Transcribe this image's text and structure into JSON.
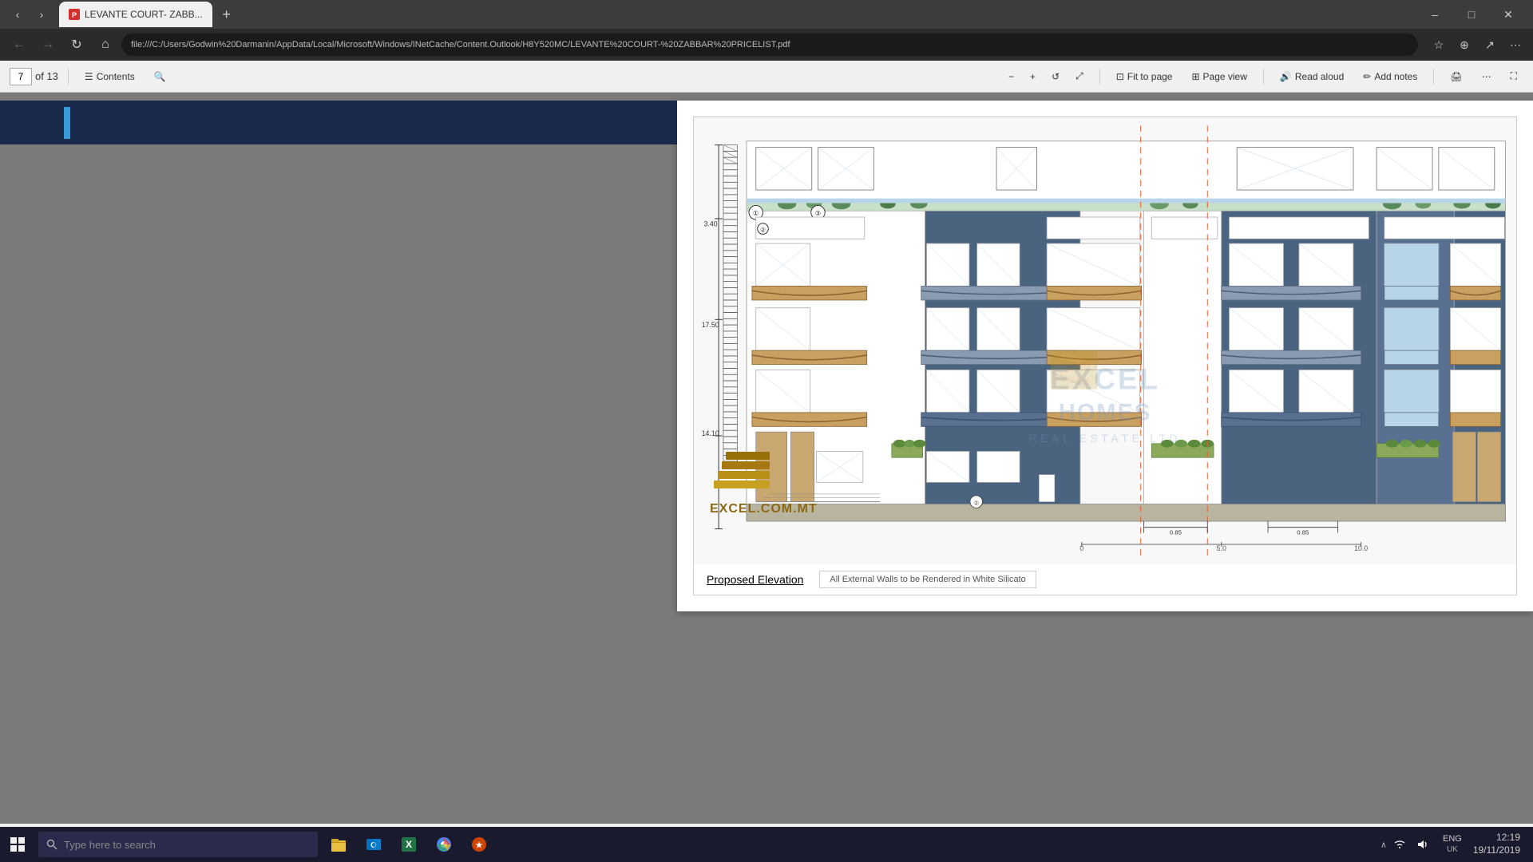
{
  "browser": {
    "tab_title": "LEVANTE COURT- ZABB...",
    "url": "file:///C:/Users/Godwin%20Darmanin/AppData/Local/Microsoft/Windows/INetCache/Content.Outlook/H8Y520MC/LEVANTE%20COURT-%20ZABBAR%20PRICELIST.pdf",
    "tab_new_label": "+",
    "win_minimize": "–",
    "win_maximize": "□",
    "win_close": "✕",
    "back_btn": "←",
    "forward_btn": "→",
    "refresh_btn": "↻",
    "home_btn": "⌂"
  },
  "pdf_toolbar": {
    "current_page": "7",
    "total_pages": "of 13",
    "contents_label": "Contents",
    "zoom_out": "−",
    "zoom_in": "+",
    "fit_to_page": "Fit to page",
    "page_view": "Page view",
    "read_aloud": "Read aloud",
    "add_notes": "Add notes",
    "print_icon": "🖨",
    "rotate_icon": "⟳"
  },
  "drawing": {
    "title": "Proposed Elevation",
    "note_text": "All External Walls to be Rendered in White Silicato",
    "scale_labels": [
      "3.40",
      "17.50",
      "14.10"
    ],
    "scale_bottom": [
      "0",
      "5.0",
      "10.0"
    ],
    "company_name": "EXCEL HOMES",
    "company_sub": "REAL ESTATE LTD",
    "website": "EXCEL.COM.MT",
    "logo_alt": "Excel Homes Logo"
  },
  "taskbar": {
    "start_icon": "⊞",
    "search_placeholder": "Type here to search",
    "lang": "ENG",
    "lang_sub": "UK",
    "time": "12:19",
    "date": "19/11/2019",
    "apps": [
      "📁",
      "📧",
      "📊",
      "🌐",
      "⚙"
    ]
  },
  "page_indicator": {
    "marker1": "①",
    "marker2": "②",
    "marker3": "③",
    "dim_085a": "0.85",
    "dim_085b": "0.85"
  }
}
